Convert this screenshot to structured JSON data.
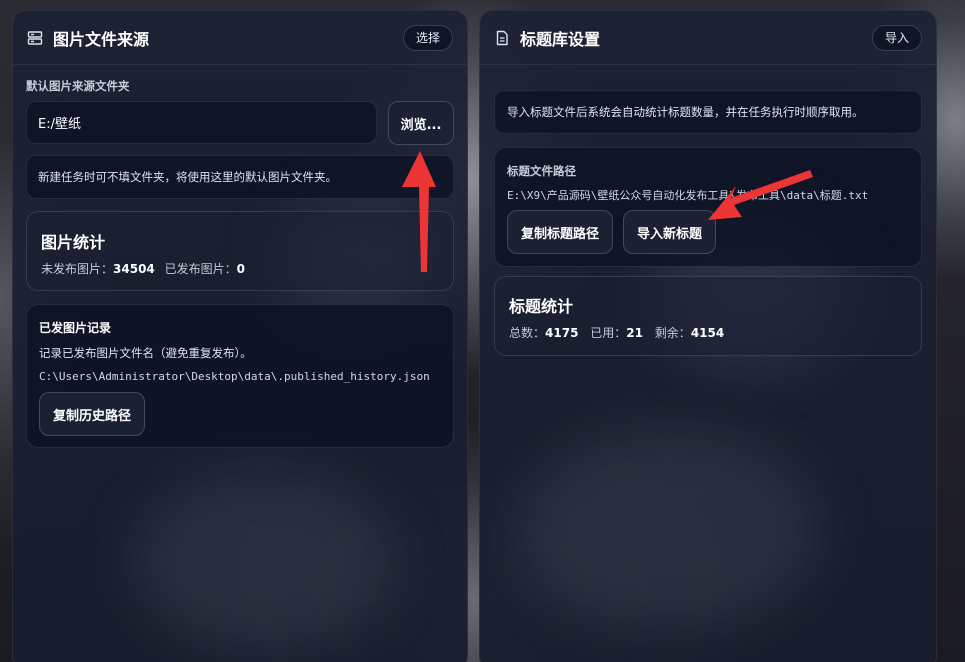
{
  "left_panel": {
    "title": "图片文件来源",
    "header_button": "选择",
    "default_folder_label": "默认图片来源文件夹",
    "folder_input_value": "E:/壁纸",
    "browse_button": "浏览...",
    "hint": "新建任务时可不填文件夹，将使用这里的默认图片文件夹。",
    "stats": {
      "title": "图片统计",
      "unpublished_label": "未发布图片：",
      "unpublished_value": "34504",
      "published_label": "已发布图片：",
      "published_value": "0"
    },
    "history": {
      "title": "已发图片记录",
      "description": "记录已发布图片文件名（避免重复发布）。",
      "path": "C:\\Users\\Administrator\\Desktop\\data\\.published_history.json",
      "copy_button": "复制历史路径"
    }
  },
  "right_panel": {
    "title": "标题库设置",
    "header_button": "导入",
    "info": "导入标题文件后系统会自动统计标题数量，并在任务执行时顺序取用。",
    "path_section": {
      "label": "标题文件路径",
      "path": "E:\\X9\\产品源码\\壁纸公众号自动化发布工具\\发布工具\\data\\标题.txt",
      "copy_button": "复制标题路径",
      "import_button": "导入新标题"
    },
    "stats": {
      "title": "标题统计",
      "total_label": "总数：",
      "total_value": "4175",
      "used_label": "已用：",
      "used_value": "21",
      "remaining_label": "剩余：",
      "remaining_value": "4154"
    }
  },
  "icons": {
    "left_header": "server-icon",
    "right_header": "document-icon",
    "annotation": "red-arrow-icon"
  },
  "colors": {
    "arrow": "#ee3535",
    "panel": "#1c2134",
    "button": "#1b2033"
  }
}
